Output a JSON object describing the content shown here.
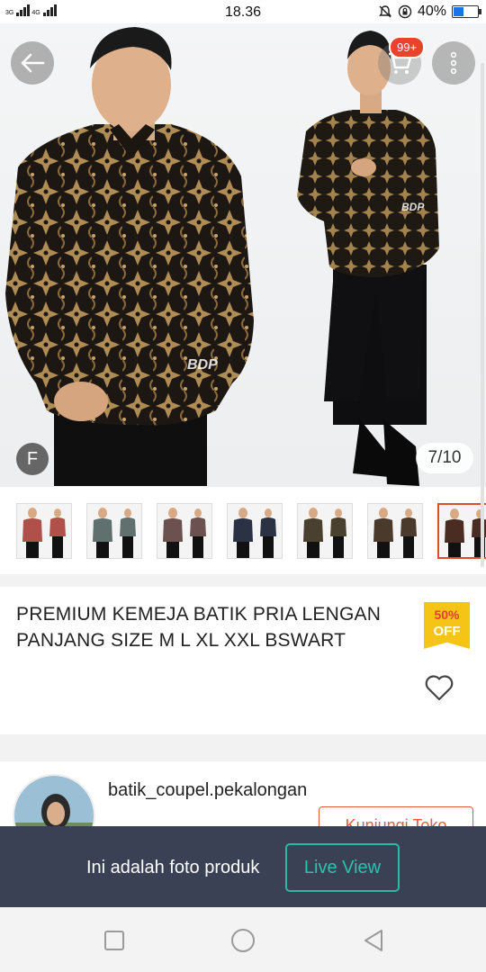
{
  "status_bar": {
    "network_1": "3G",
    "network_2": "4G",
    "time": "18.36",
    "battery_percent": "40%",
    "battery_level": 0.4
  },
  "product": {
    "image_counter": "7/10",
    "f_badge": "F",
    "cart_count": "99+",
    "watermark": "BDP",
    "title": "PREMIUM KEMEJA BATIK PRIA LENGAN PANJANG SIZE M L XL XXL BSWART",
    "discount_percent": "50%",
    "discount_label": "OFF",
    "thumbnail_count": 8,
    "active_thumbnail": 6
  },
  "store": {
    "name": "batik_coupel.pekalongan",
    "visit_label": "Kunjungi Toko"
  },
  "banner": {
    "text": "Ini adalah foto produk",
    "live_view_label": "Live View"
  },
  "icons": {
    "back": "arrow-left-icon",
    "cart": "cart-icon",
    "menu": "more-vert-icon",
    "favorite": "heart-icon",
    "nav_recent": "square-icon",
    "nav_home": "circle-icon",
    "nav_back": "triangle-back-icon"
  },
  "colors": {
    "accent": "#e55b3c",
    "badge": "#e8432c",
    "discount_bg": "#f6c416",
    "banner_bg": "#3a4155",
    "live_view": "#2bc2ae",
    "battery": "#1a73e8"
  }
}
